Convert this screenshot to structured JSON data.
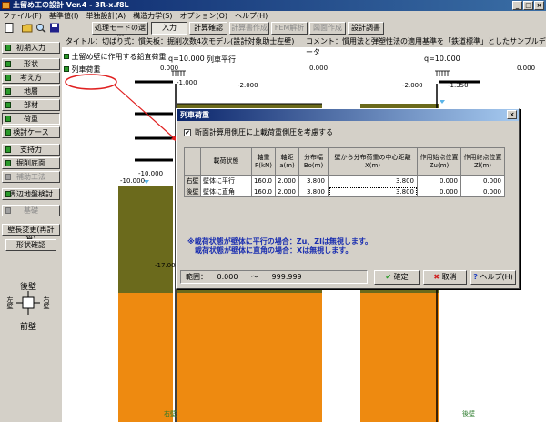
{
  "window": {
    "title": "土留め工の設計 Ver.4 - 3R-x.f8L"
  },
  "menu": [
    "ファイル(F)",
    "基準値(I)",
    "単独設計(A)",
    "構造力学(S)",
    "オプション(O)",
    "ヘルプ(H)"
  ],
  "toolbar": {
    "mode_select": "処理モードの選択",
    "input": "入力",
    "calc_check": "計算確認",
    "calc_doc": "計算書作成",
    "fem": "FEM解析",
    "drawing": "図面作成",
    "design_doc": "設計調書"
  },
  "sidebar": {
    "items": [
      {
        "label": "初期入力",
        "led": true,
        "enabled": true
      },
      {
        "label": "形状",
        "led": true,
        "enabled": true
      },
      {
        "label": "考え方",
        "led": true,
        "enabled": true
      },
      {
        "label": "地層",
        "led": true,
        "enabled": true
      },
      {
        "label": "部材",
        "led": true,
        "enabled": true
      },
      {
        "label": "荷重",
        "led": true,
        "enabled": true,
        "selected": true
      },
      {
        "label": "検討ケース",
        "led": true,
        "enabled": true
      },
      {
        "label": "支持力",
        "led": true,
        "enabled": true
      },
      {
        "label": "掘削底面",
        "led": true,
        "enabled": true
      },
      {
        "label": "補助工法",
        "led": false,
        "enabled": false
      },
      {
        "label": "周辺地盤検討",
        "led": true,
        "enabled": true
      },
      {
        "label": "基礎",
        "led": false,
        "enabled": false
      },
      {
        "label": "壁長変更(再計算)",
        "led": false,
        "enabled": true
      },
      {
        "label": "形状確認",
        "led": false,
        "enabled": true
      }
    ],
    "compass": {
      "north": "後壁",
      "south": "前壁",
      "west": "左壁",
      "east": "右壁"
    }
  },
  "main": {
    "title_label": "タイトル：切ばり式：慣矢板：掘削次数4次モデル(設計対象助士左壁)",
    "comment_label": "コメント：慣用法と弾塑性法の適用基準を「鉄道標準」としたサンプルデータ",
    "legend": {
      "ground_load": "土留め壁に作用する鉛直荷重",
      "train_load": "列車荷重"
    },
    "load_labels": {
      "left_q": "q=10.000",
      "left_dir": "列車平行",
      "right_q": "q=10.000"
    },
    "elevations": {
      "top_left": "0.000",
      "top_mid": "0.000",
      "top_right": "0.000",
      "l1": "-1.000",
      "l2": "-2.000",
      "r1": "-2.000",
      "r2": "-1.350",
      "left_top": "-10.000",
      "left_top2": "-10.000",
      "deep": "-17.000"
    },
    "wall_labels": {
      "left": "右壁",
      "right": "後壁"
    }
  },
  "dialog": {
    "title": "列車荷重",
    "checkbox_label": "断面計算用側圧に上載荷重側圧を考慮する",
    "checkbox_checked": true,
    "headers": {
      "state": "載荷状態",
      "axle": "軸重",
      "axle_unit": "P(kN)",
      "axle_dist": "軸距",
      "axle_dist_unit": "a(m)",
      "spread": "分布幅",
      "spread_unit": "Bo(m)",
      "center_dist": "壁から分布荷重の中心距離",
      "center_dist_unit": "X(m)",
      "start": "作用始点位置",
      "start_unit": "Zu(m)",
      "end": "作用終点位置",
      "end_unit": "Zl(m)"
    },
    "rows": [
      {
        "wall": "右壁",
        "state": "壁体に平行",
        "P": "160.0",
        "a": "2.000",
        "Bo": "3.800",
        "X": "3.800",
        "Zu": "0.000",
        "Zl": "0.000"
      },
      {
        "wall": "後壁",
        "state": "壁体に直角",
        "P": "160.0",
        "a": "2.000",
        "Bo": "3.800",
        "X": "3.800",
        "Zu": "0.000",
        "Zl": "0.000"
      }
    ],
    "note_1": "※載荷状態が壁体に平行の場合：Zu、Zlは無視します。",
    "note_2": "　載荷状態が壁体に直角の場合：Xは無視します。",
    "range_label": "範囲：",
    "range_min": "0.000",
    "range_sep": "〜",
    "range_max": "999.999",
    "ok": "確定",
    "cancel": "取消",
    "help": "ヘルプ(H)"
  },
  "colors": {
    "soil_top": "#6b6a1c",
    "soil_bottom": "#ee8a10",
    "title_bar": "#0a246a"
  }
}
